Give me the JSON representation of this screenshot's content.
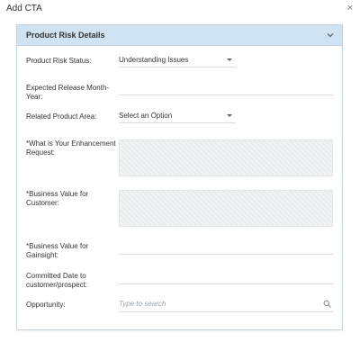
{
  "dialog": {
    "title": "Add CTA",
    "close_glyph": "×"
  },
  "panel": {
    "title": "Product Risk Details",
    "toggle_icon": "chevron-down-icon"
  },
  "fields": {
    "product_risk_status": {
      "label": "Product Risk Status:",
      "value": "Understanding Issues"
    },
    "expected_release": {
      "label": "Expected Release Month-Year:",
      "value": ""
    },
    "related_product_area": {
      "label": "Related Product Area:",
      "value": "Select an Option"
    },
    "enhancement_request": {
      "label": "*What is Your Enhancement Request:",
      "value": ""
    },
    "business_value_customer": {
      "label": "*Business Value for Customer:",
      "value": ""
    },
    "business_value_gainsight": {
      "label": "*Business Value for Gainsight:",
      "value": ""
    },
    "committed_date": {
      "label": "Committed Date to customer/prospect:",
      "value": ""
    },
    "opportunity": {
      "label": "Opportunity:",
      "placeholder": "Type to search",
      "search_icon": "search-icon"
    }
  }
}
